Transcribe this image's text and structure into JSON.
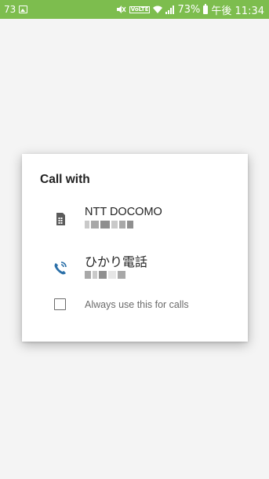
{
  "status_bar": {
    "notification_count": "73",
    "battery_percent": "73%",
    "time": "午後 11:34",
    "volte_label": "VoLTE",
    "icons": [
      "image-icon",
      "mute-icon",
      "volte-icon",
      "wifi-icon",
      "signal-icon",
      "battery-icon"
    ],
    "color": "#7dbd4e"
  },
  "dialog": {
    "title": "Call with",
    "options": [
      {
        "label": "NTT DOCOMO",
        "icon": "sim-card-icon"
      },
      {
        "label": "ひかり電話",
        "icon": "phone-call-icon"
      }
    ],
    "checkbox_label": "Always use this for calls",
    "checkbox_checked": false
  },
  "colors": {
    "accent_blue": "#2a6fa8"
  }
}
